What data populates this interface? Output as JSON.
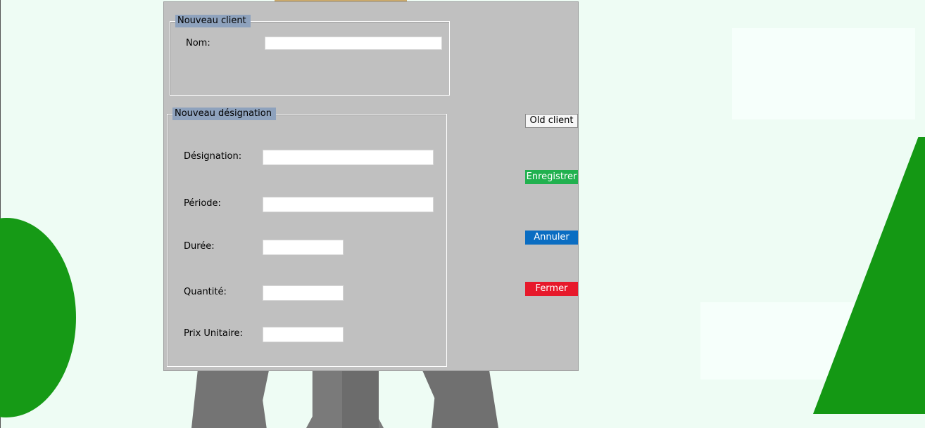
{
  "dialog": {
    "client_group": {
      "title": "Nouveau client",
      "fields": {
        "nom": {
          "label": "Nom:",
          "value": ""
        }
      }
    },
    "designation_group": {
      "title": "Nouveau désignation",
      "fields": {
        "designation": {
          "label": "Désignation:",
          "value": ""
        },
        "periode": {
          "label": "Période:",
          "value": ""
        },
        "duree": {
          "label": "Durée:",
          "value": ""
        },
        "quantite": {
          "label": "Quantité:",
          "value": ""
        },
        "prix_unitaire": {
          "label": "Prix Unitaire:",
          "value": ""
        }
      }
    },
    "buttons": {
      "old_client": "Old client",
      "save": "Enregistrer",
      "cancel": "Annuler",
      "close": "Fermer"
    }
  },
  "colors": {
    "dialog_background": "#c0c0c0",
    "group_title_background": "#8ea2bd",
    "save_button": "#21b14f",
    "cancel_button": "#0a6dc2",
    "close_button": "#e7192b",
    "background_green": "#169a16"
  }
}
